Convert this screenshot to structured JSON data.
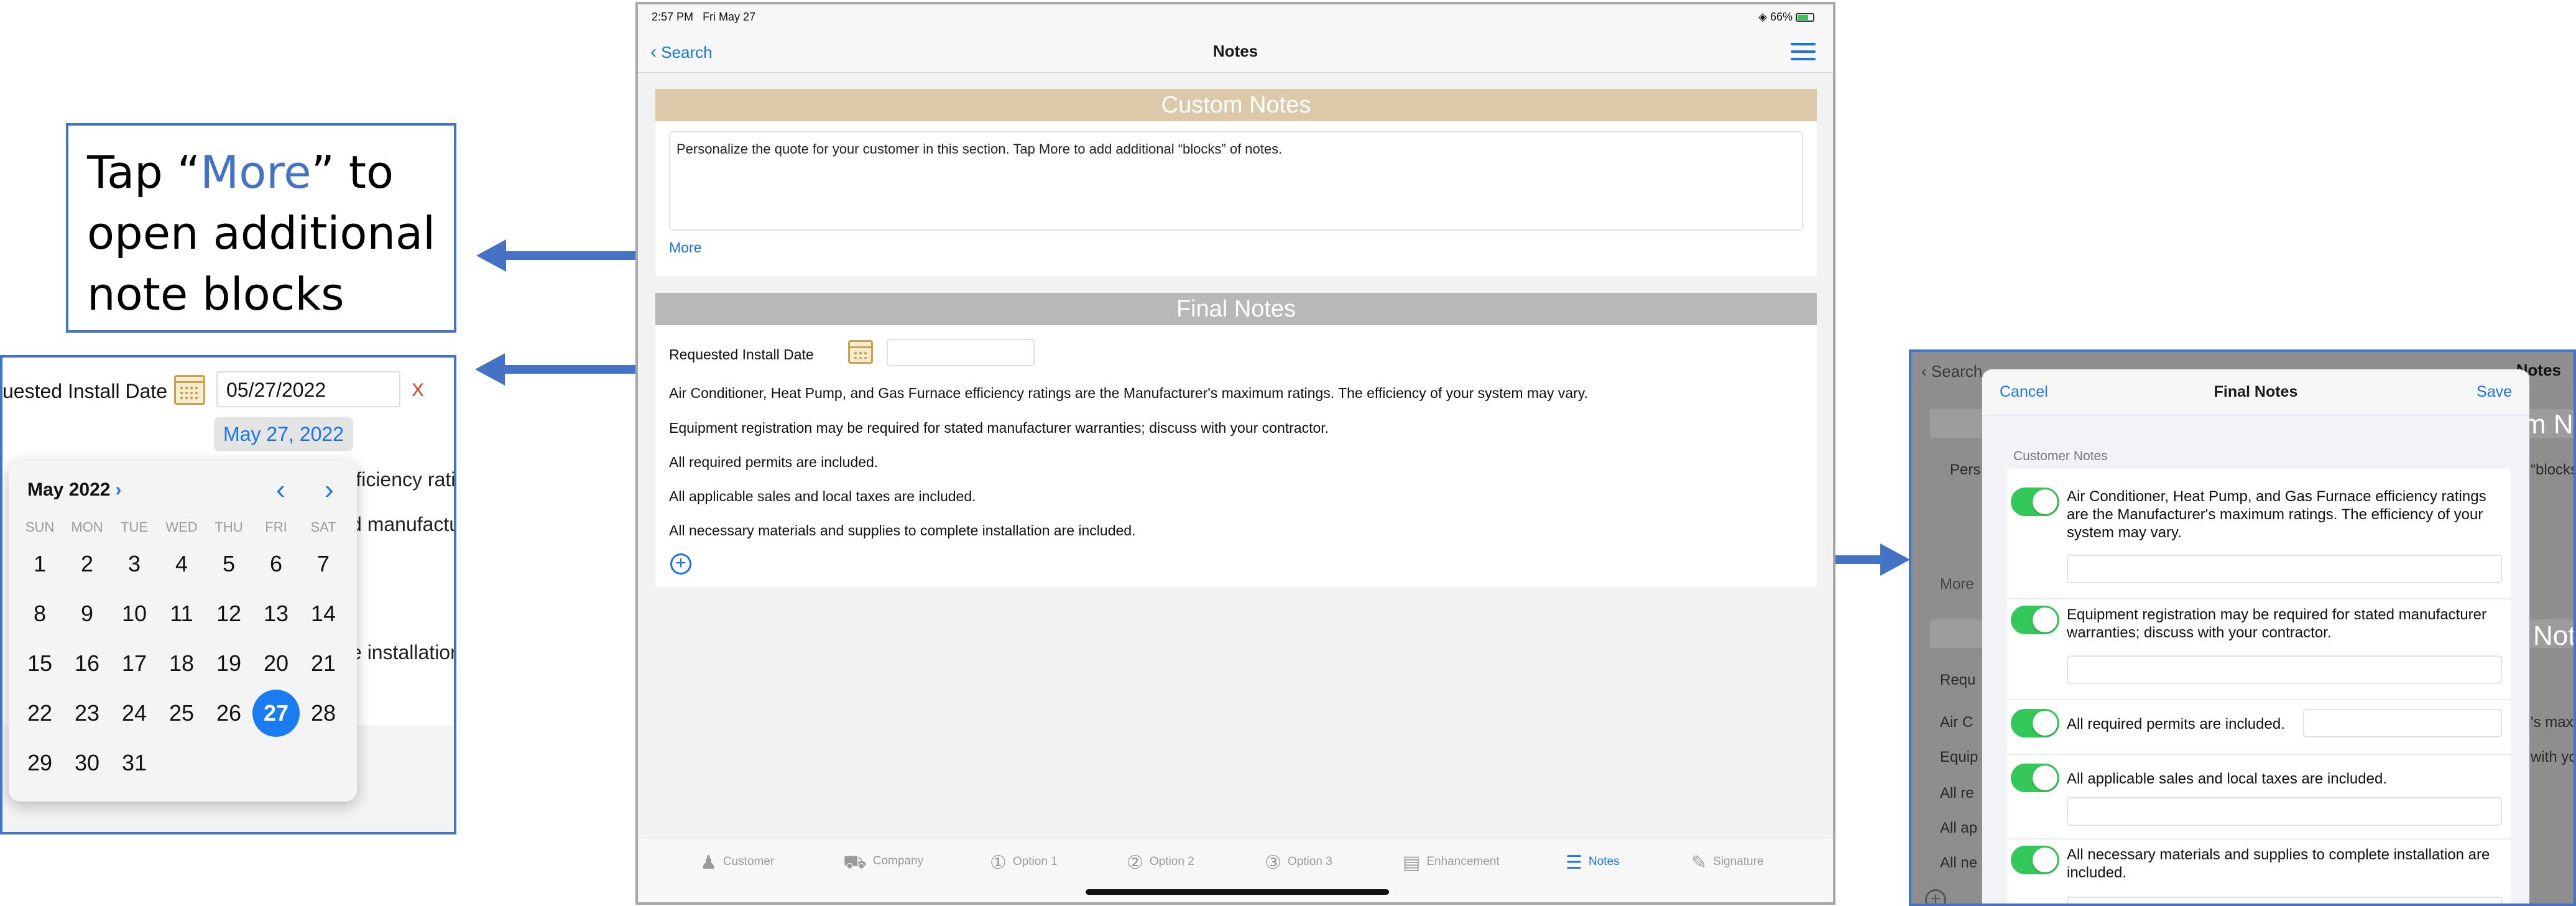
{
  "callout": {
    "line1_pre": "Tap “",
    "line1_accent": "More",
    "line1_post": "” to",
    "line2": "open additional",
    "line3": "note blocks"
  },
  "ipad": {
    "status": {
      "time": "2:57 PM",
      "date": "Fri May 27",
      "battery": "66%"
    },
    "nav": {
      "back_label": "Search",
      "title": "Notes"
    },
    "custom_notes": {
      "header": "Custom Notes",
      "text": "Personalize the quote for your customer in this section. Tap More to add additional “blocks” of notes.",
      "more_label": "More"
    },
    "final_notes": {
      "header": "Final Notes",
      "install_label": "Requested Install Date",
      "lines": [
        "Air Conditioner, Heat Pump, and Gas Furnace efficiency ratings are the Manufacturer's maximum ratings. The efficiency of your system may vary.",
        "Equipment registration may be required for stated manufacturer warranties; discuss with your contractor.",
        "All required permits are included.",
        "All applicable sales and local taxes are included.",
        "All necessary materials and supplies to complete installation are included."
      ]
    },
    "tabs": [
      {
        "label": "Customer",
        "icon": "person-icon"
      },
      {
        "label": "Company",
        "icon": "truck-icon"
      },
      {
        "label": "Option 1",
        "icon": "circle-1-icon"
      },
      {
        "label": "Option 2",
        "icon": "circle-2-icon"
      },
      {
        "label": "Option 3",
        "icon": "circle-3-icon"
      },
      {
        "label": "Enhancement",
        "icon": "list-icon"
      },
      {
        "label": "Notes",
        "icon": "lines-icon",
        "active": true
      },
      {
        "label": "Signature",
        "icon": "signature-icon"
      }
    ]
  },
  "calendar_panel": {
    "label": "uested Install Date",
    "date_value": "05/27/2022",
    "clear": "X",
    "chip": "May 27, 2022",
    "month": "May 2022",
    "weekdays": [
      "SUN",
      "MON",
      "TUE",
      "WED",
      "THU",
      "FRI",
      "SAT"
    ],
    "days": [
      "1",
      "2",
      "3",
      "4",
      "5",
      "6",
      "7",
      "8",
      "9",
      "10",
      "11",
      "12",
      "13",
      "14",
      "15",
      "16",
      "17",
      "18",
      "19",
      "20",
      "21",
      "22",
      "23",
      "24",
      "25",
      "26",
      "27",
      "28",
      "29",
      "30",
      "31"
    ],
    "selected_day": "27",
    "bg_fragments": [
      "fficiency rati",
      "d manufactu",
      "e installation"
    ]
  },
  "modal_panel": {
    "bg_search": "Search",
    "bg_notes": "Notes",
    "bg_fragments": {
      "pers": "Pers",
      "more": "More",
      "requ": "Requ",
      "airc": "Air C",
      "equip": "Equip",
      "allre": "All re",
      "allap": "All ap",
      "allne": "All ne",
      "mno": "m No",
      "blocks": "“blocks",
      "not": "Not",
      "smax": "'s max",
      "withyou": "with you"
    },
    "cancel": "Cancel",
    "title": "Final Notes",
    "save": "Save",
    "section_label": "Customer Notes",
    "options": [
      "Air Conditioner, Heat Pump, and Gas Furnace efficiency ratings are the Manufacturer's maximum ratings. The efficiency of your system may vary.",
      "Equipment registration may be required for stated manufacturer warranties; discuss with your contractor.",
      "All required permits are included.",
      "All applicable sales and local taxes are included.",
      "All necessary materials and supplies to complete installation are included."
    ]
  }
}
